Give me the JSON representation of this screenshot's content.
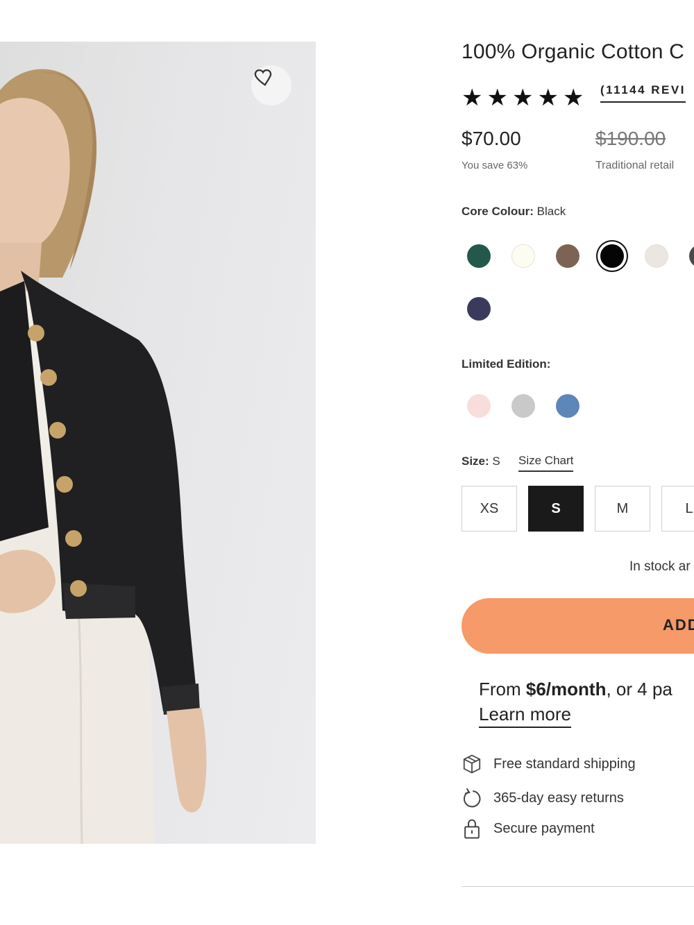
{
  "product": {
    "title": "100% Organic Cotton C",
    "rating_stars": 5,
    "reviews": "(11144 REVI",
    "price": "$70.00",
    "savings": "You save 63%",
    "original_price": "$190.00",
    "retail_label": "Traditional retail"
  },
  "colors": {
    "core_label": "Core Colour:",
    "core_value": "Black",
    "core": [
      {
        "name": "green",
        "hex": "#24584a"
      },
      {
        "name": "ivory",
        "hex": "#fdfcf1"
      },
      {
        "name": "brown",
        "hex": "#7d6354"
      },
      {
        "name": "black",
        "hex": "#050505",
        "selected": true
      },
      {
        "name": "oatmeal",
        "hex": "#ebe6df"
      },
      {
        "name": "charcoal",
        "hex": "#4a4a4a"
      },
      {
        "name": "navy",
        "hex": "#3a3b5c"
      }
    ],
    "limited_label": "Limited Edition:",
    "limited": [
      {
        "name": "blush",
        "hex": "#f8dddd"
      },
      {
        "name": "grey",
        "hex": "#c9c9c9"
      },
      {
        "name": "blue",
        "hex": "#5d86b9"
      }
    ]
  },
  "size": {
    "label": "Size:",
    "value": "S",
    "chart_link": "Size Chart",
    "options": [
      "XS",
      "S",
      "M",
      "L"
    ],
    "selected": "S"
  },
  "stock_text": "In stock ar",
  "add_to_cart": "ADD",
  "financing": {
    "prefix": "From ",
    "amount": "$6/month",
    "suffix": ", or 4 pa",
    "learn_more": "Learn more"
  },
  "features": [
    {
      "icon": "box-icon",
      "text": "Free standard shipping"
    },
    {
      "icon": "return-arrow-icon",
      "text": "365-day easy returns"
    },
    {
      "icon": "lock-icon",
      "text": "Secure payment"
    }
  ]
}
